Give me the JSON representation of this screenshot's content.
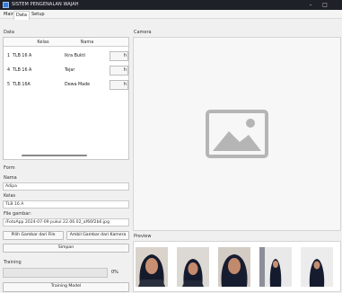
{
  "window": {
    "title": "SISTEM PENGENALAN WAJAH"
  },
  "menu": {
    "items": [
      "Main",
      "Data",
      "Setup"
    ]
  },
  "data_group": {
    "label": "Data",
    "columns": [
      "Kelas",
      "Nama"
    ],
    "rows": [
      {
        "no": "1",
        "kelas": "TLB 16 A",
        "nama": "Ikra Bukti"
      },
      {
        "no": "4",
        "kelas": "TLB 16 A",
        "nama": "Tejar"
      },
      {
        "no": "5",
        "kelas": "TLB 16A",
        "nama": "Dewa Made"
      }
    ],
    "row_button_glyph": "h"
  },
  "camera_group": {
    "label": "Camera"
  },
  "form": {
    "label": "Form",
    "name_label": "Nama",
    "name_value": "Adipa",
    "class_label": "Kelas",
    "class_value": "TLB 16 A",
    "file_label": "File gambar:",
    "file_value": "/FotoApp 2024-07-09 pukul 22.06.02_af66f2b6.jpg",
    "pick_file_button": "Pilih Gambar dari File",
    "camera_button": "Ambil Gambar dari Kamera",
    "save_button": "Simpan"
  },
  "training": {
    "label": "Training",
    "progress_text": "0%",
    "progress": 0,
    "button": "Training Model"
  },
  "preview": {
    "label": "Preview"
  },
  "colors": {
    "titlebar": "#1f2129",
    "placeholder_icon": "#b5b5b5",
    "hijab_dark": "#151b2e",
    "skin": "#c89072"
  }
}
